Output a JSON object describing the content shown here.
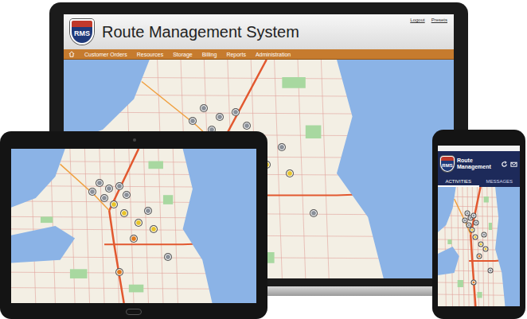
{
  "laptop": {
    "logo": "RMS",
    "title": "Route Management System",
    "header_links": [
      "Logout",
      "Presets"
    ],
    "nav_items": [
      "Customer Orders",
      "Resources",
      "Storage",
      "Billing",
      "Reports",
      "Administration"
    ]
  },
  "phone": {
    "logo": "RMS",
    "title": "Route Management",
    "tabs": [
      {
        "label": "ACTIVITIES",
        "selected": true
      },
      {
        "label": "MESSAGES",
        "selected": false
      }
    ]
  },
  "map": {
    "pins": [
      {
        "color": "#8a9099"
      },
      {
        "color": "#8a9099"
      },
      {
        "color": "#8a9099"
      },
      {
        "color": "#8a9099"
      },
      {
        "color": "#8a9099"
      },
      {
        "color": "#8a9099"
      },
      {
        "color": "#8a9099"
      },
      {
        "color": "#8a9099"
      },
      {
        "color": "#e8c42a"
      },
      {
        "color": "#e8c42a"
      },
      {
        "color": "#e8c42a"
      },
      {
        "color": "#e8c42a"
      },
      {
        "color": "#e07b1f"
      },
      {
        "color": "#e07b1f"
      }
    ]
  }
}
